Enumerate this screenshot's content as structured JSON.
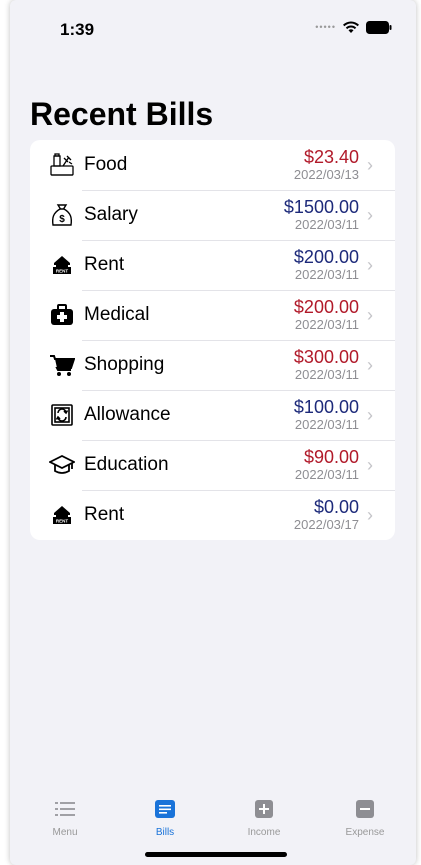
{
  "status": {
    "time": "1:39"
  },
  "header": {
    "title": "Recent Bills"
  },
  "bills": [
    {
      "icon": "food-icon",
      "label": "Food",
      "amount": "$23.40",
      "date": "2022/03/13",
      "kind": "expense"
    },
    {
      "icon": "money-bag-icon",
      "label": "Salary",
      "amount": "$1500.00",
      "date": "2022/03/11",
      "kind": "income"
    },
    {
      "icon": "rent-house-icon",
      "label": "Rent",
      "amount": "$200.00",
      "date": "2022/03/11",
      "kind": "income"
    },
    {
      "icon": "medical-kit-icon",
      "label": "Medical",
      "amount": "$200.00",
      "date": "2022/03/11",
      "kind": "expense"
    },
    {
      "icon": "shopping-cart-icon",
      "label": "Shopping",
      "amount": "$300.00",
      "date": "2022/03/11",
      "kind": "expense"
    },
    {
      "icon": "allowance-icon",
      "label": "Allowance",
      "amount": "$100.00",
      "date": "2022/03/11",
      "kind": "income"
    },
    {
      "icon": "graduation-cap-icon",
      "label": "Education",
      "amount": "$90.00",
      "date": "2022/03/11",
      "kind": "expense"
    },
    {
      "icon": "rent-house-icon",
      "label": "Rent",
      "amount": "$0.00",
      "date": "2022/03/17",
      "kind": "income"
    }
  ],
  "tabs": [
    {
      "icon": "menu-list-icon",
      "label": "Menu",
      "active": false
    },
    {
      "icon": "bills-icon",
      "label": "Bills",
      "active": true
    },
    {
      "icon": "plus-square-icon",
      "label": "Income",
      "active": false
    },
    {
      "icon": "minus-square-icon",
      "label": "Expense",
      "active": false
    }
  ],
  "colors": {
    "expense": "#b11a2a",
    "income": "#1d2a7a",
    "accent": "#1a73d9"
  }
}
